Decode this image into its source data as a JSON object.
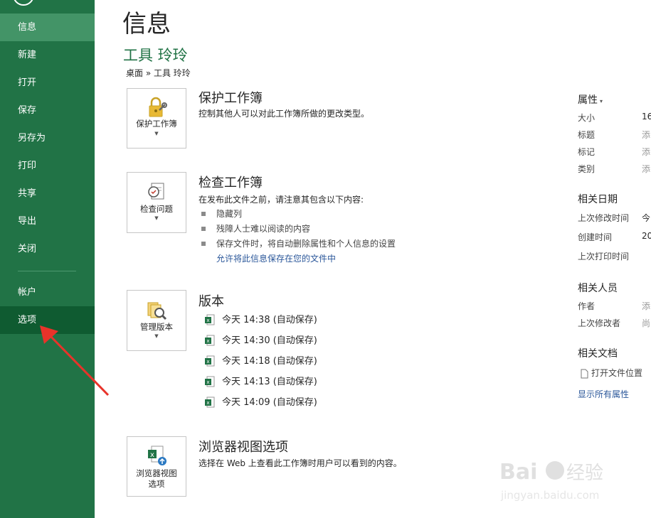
{
  "sidebar": {
    "items": [
      {
        "label": "信息"
      },
      {
        "label": "新建"
      },
      {
        "label": "打开"
      },
      {
        "label": "保存"
      },
      {
        "label": "另存为"
      },
      {
        "label": "打印"
      },
      {
        "label": "共享"
      },
      {
        "label": "导出"
      },
      {
        "label": "关闭"
      },
      {
        "label": "帐户"
      },
      {
        "label": "选项"
      }
    ]
  },
  "page": {
    "title": "信息",
    "doc_title": "工具 玲玲",
    "breadcrumb": "桌面 » 工具 玲玲"
  },
  "protect": {
    "tile_label": "保护工作簿",
    "title": "保护工作簿",
    "desc": "控制其他人可以对此工作簿所做的更改类型。"
  },
  "inspect": {
    "tile_label": "检查问题",
    "title": "检查工作簿",
    "desc": "在发布此文件之前，请注意其包含以下内容:",
    "bullets": [
      "隐藏列",
      "残障人士难以阅读的内容",
      "保存文件时，将自动删除属性和个人信息的设置"
    ],
    "link": "允许将此信息保存在您的文件中"
  },
  "versions": {
    "tile_label": "管理版本",
    "title": "版本",
    "items": [
      "今天 14:38 (自动保存)",
      "今天 14:30 (自动保存)",
      "今天 14:18 (自动保存)",
      "今天 14:13 (自动保存)",
      "今天 14:09 (自动保存)"
    ]
  },
  "browser": {
    "tile_label_1": "浏览器视图",
    "tile_label_2": "选项",
    "title": "浏览器视图选项",
    "desc": "选择在 Web 上查看此工作簿时用户可以看到的内容。"
  },
  "properties": {
    "header": "属性",
    "rows": [
      {
        "label": "大小",
        "value": "16"
      },
      {
        "label": "标题",
        "value": "添"
      },
      {
        "label": "标记",
        "value": "添"
      },
      {
        "label": "类别",
        "value": "添"
      }
    ],
    "dates_header": "相关日期",
    "dates": [
      {
        "label": "上次修改时间",
        "value": "今"
      },
      {
        "label": "创建时间",
        "value": "20"
      },
      {
        "label": "上次打印时间",
        "value": ""
      }
    ],
    "people_header": "相关人员",
    "people": [
      {
        "label": "作者",
        "value": "添"
      },
      {
        "label": "上次修改者",
        "value": "尚"
      }
    ],
    "docs_header": "相关文档",
    "open_location": "打开文件位置",
    "show_all": "显示所有属性"
  },
  "colors": {
    "sidebar": "#217346",
    "sidebar_active": "#439467",
    "sidebar_selected": "#0f5b31",
    "accent": "#217346",
    "link": "#2b579a",
    "annotation_arrow": "#e8332a"
  },
  "watermark": {
    "line1": "Bai du 经验",
    "line2": "jingyan.baidu.com"
  }
}
